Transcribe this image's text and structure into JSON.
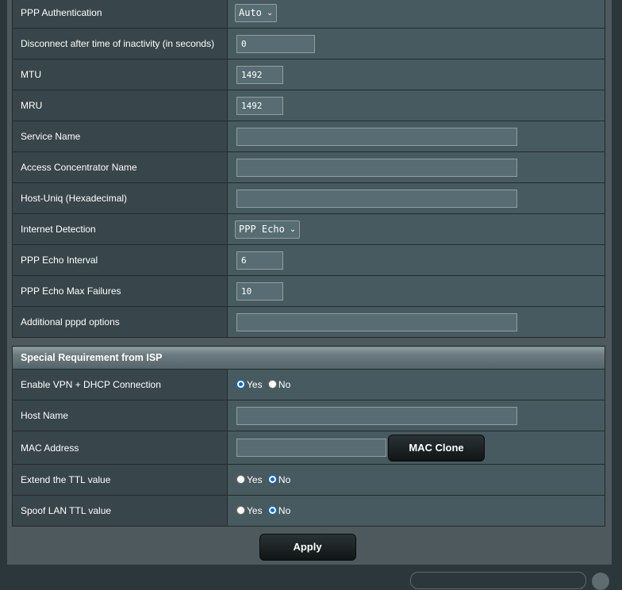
{
  "ppp_rows": [
    {
      "label": "PPP Authentication",
      "type": "select",
      "value": "Auto",
      "width": "auto"
    },
    {
      "label": "Disconnect after time of inactivity (in seconds)",
      "type": "text",
      "value": "0",
      "size": "m"
    },
    {
      "label": "MTU",
      "type": "text",
      "value": "1492",
      "size": "s"
    },
    {
      "label": "MRU",
      "type": "text",
      "value": "1492",
      "size": "s"
    },
    {
      "label": "Service Name",
      "type": "text",
      "value": "",
      "size": "l"
    },
    {
      "label": "Access Concentrator Name",
      "type": "text",
      "value": "",
      "size": "l"
    },
    {
      "label": "Host-Uniq (Hexadecimal)",
      "type": "text",
      "value": "",
      "size": "l"
    },
    {
      "label": "Internet Detection",
      "type": "select",
      "value": "PPP Echo"
    },
    {
      "label": "PPP Echo Interval",
      "type": "text",
      "value": "6",
      "size": "s"
    },
    {
      "label": "PPP Echo Max Failures",
      "type": "text",
      "value": "10",
      "size": "s"
    },
    {
      "label": "Additional pppd options",
      "type": "text",
      "value": "",
      "size": "l"
    }
  ],
  "isp_section": {
    "title": "Special Requirement from ISP",
    "enable_vpn_dhcp": {
      "label": "Enable VPN + DHCP Connection",
      "yes": "Yes",
      "no": "No",
      "selected": "yes"
    },
    "host_name": {
      "label": "Host Name",
      "value": ""
    },
    "mac_address": {
      "label": "MAC Address",
      "value": "",
      "button": "MAC Clone"
    },
    "extend_ttl": {
      "label": "Extend the TTL value",
      "yes": "Yes",
      "no": "No",
      "selected": "no"
    },
    "spoof_ttl": {
      "label": "Spoof LAN TTL value",
      "yes": "Yes",
      "no": "No",
      "selected": "no"
    }
  },
  "apply_label": "Apply",
  "icons": {
    "select_chevron": "chevron-down-icon"
  }
}
